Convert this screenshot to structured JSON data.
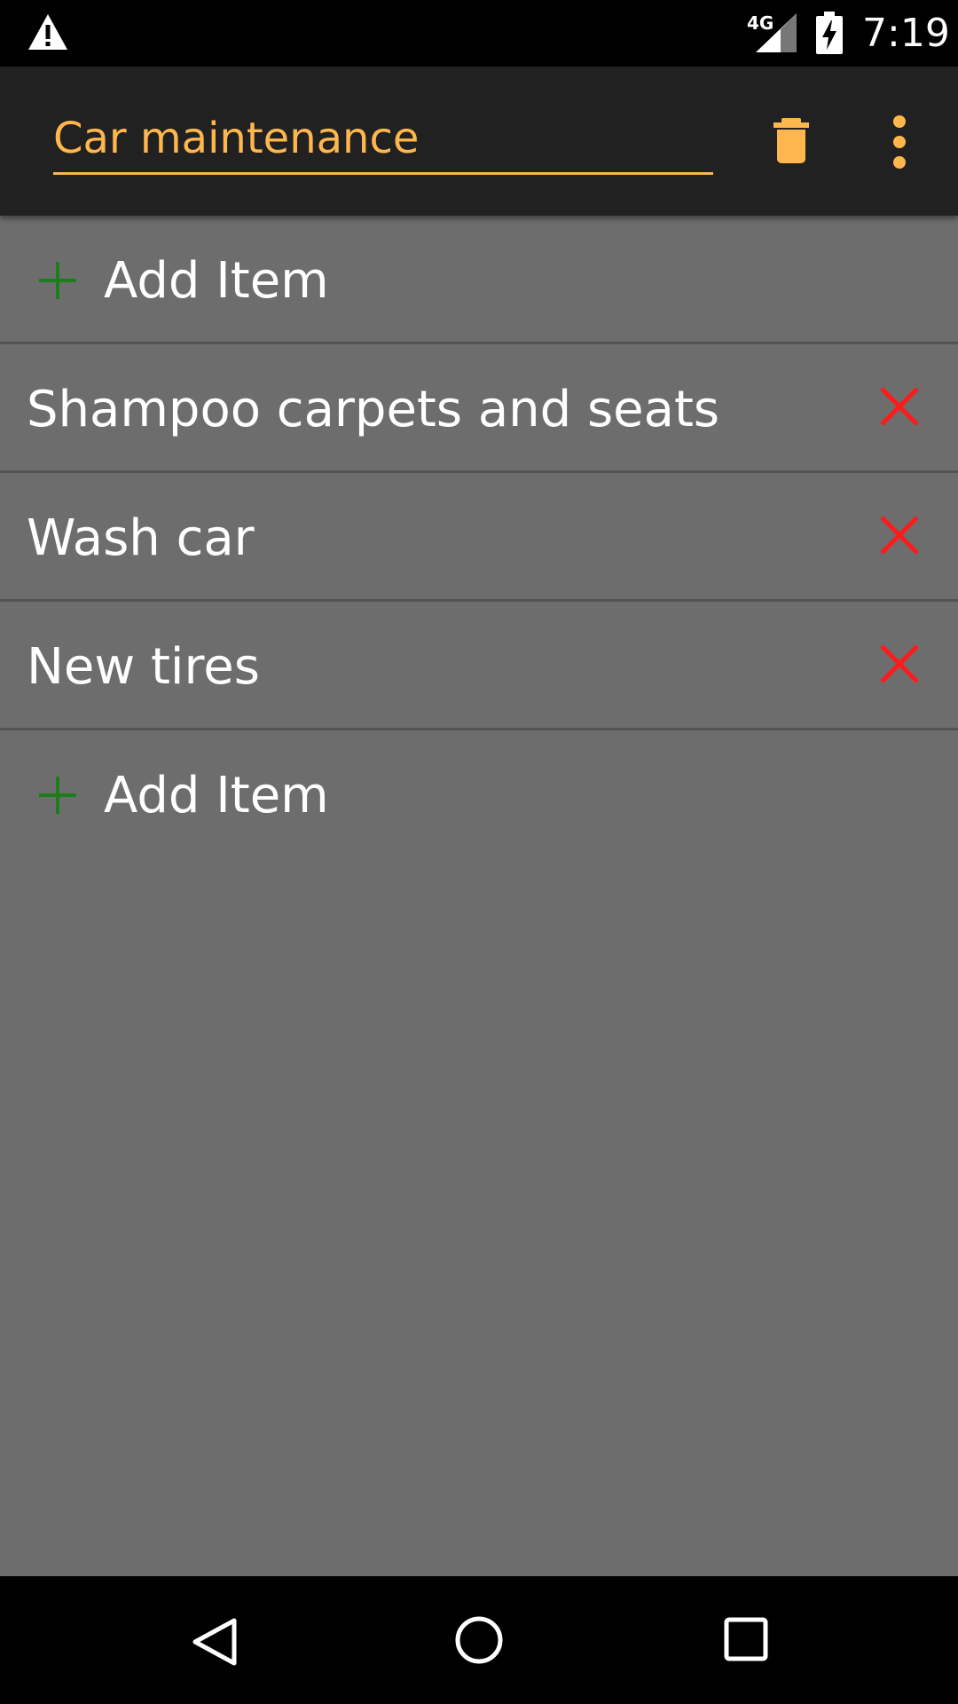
{
  "status_bar": {
    "network": "4G",
    "time": "7:19",
    "icons": [
      "warning-icon",
      "signal-icon",
      "battery-charging-icon"
    ]
  },
  "toolbar": {
    "title_value": "Car maintenance",
    "actions": [
      "trash-icon",
      "overflow-menu-icon"
    ],
    "accent_color": "#ffb74d"
  },
  "list": {
    "add_label_top": "Add Item",
    "items": [
      {
        "label": "Shampoo carpets and seats"
      },
      {
        "label": "Wash car"
      },
      {
        "label": "New tires"
      }
    ],
    "add_label_bottom": "Add Item",
    "plus_color": "#1b7e1b",
    "delete_color": "#ff1a1a"
  },
  "nav_bar": {
    "buttons": [
      "back-icon",
      "home-icon",
      "recents-icon"
    ]
  }
}
